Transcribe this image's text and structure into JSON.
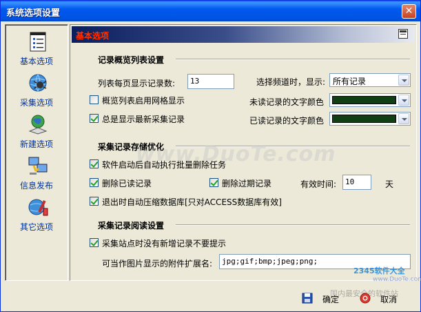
{
  "window": {
    "title": "系统选项设置",
    "close_symbol": "✕"
  },
  "sidebar": {
    "items": [
      {
        "label": "基本选项",
        "icon": "list-document-icon"
      },
      {
        "label": "采集选项",
        "icon": "globe-spider-icon"
      },
      {
        "label": "新建选项",
        "icon": "globe-network-icon"
      },
      {
        "label": "信息发布",
        "icon": "publish-computer-icon"
      },
      {
        "label": "其它选项",
        "icon": "globe-tools-icon"
      }
    ]
  },
  "header": {
    "title": "基本选项"
  },
  "overview": {
    "section_title": "记录概览列表设置",
    "per_page_label": "列表每页显示记录数:",
    "per_page_value": "13",
    "channel_label": "选择频道时，显示:",
    "channel_value": "所有记录",
    "grid_label": "概览列表启用网格显示",
    "grid_checked": false,
    "unread_color_label": "未读记录的文字颜色",
    "unread_color": "#0F3F12",
    "latest_label": "总是显示最新采集记录",
    "latest_checked": true,
    "read_color_label": "已读记录的文字颜色",
    "read_color": "#0F3F12"
  },
  "storage": {
    "section_title": "采集记录存储优化",
    "batch_delete_label": "软件启动后自动执行批量删除任务",
    "batch_delete_checked": true,
    "delete_read_label": "删除已读记录",
    "delete_read_checked": true,
    "delete_expired_label": "删除过期记录",
    "delete_expired_checked": true,
    "valid_time_label": "有效时间:",
    "valid_time_value": "10",
    "valid_time_unit": "天",
    "compress_label": "退出时自动压缩数据库[只对ACCESS数据库有效]",
    "compress_checked": true
  },
  "reading": {
    "section_title": "采集记录阅读设置",
    "no_prompt_label": "采集站点时没有新增记录不要提示",
    "no_prompt_checked": true,
    "ext_label": "可当作图片显示的附件扩展名:",
    "ext_value": "jpg;gif;bmp;jpeg;png;"
  },
  "footer": {
    "ok_label": "确定",
    "cancel_label": "取消"
  },
  "watermark": {
    "main": "www.DuoTe.com",
    "brand": "2345软件大全",
    "site": "www.DuoTe.com",
    "tagline": "国内最安全的软件站"
  }
}
